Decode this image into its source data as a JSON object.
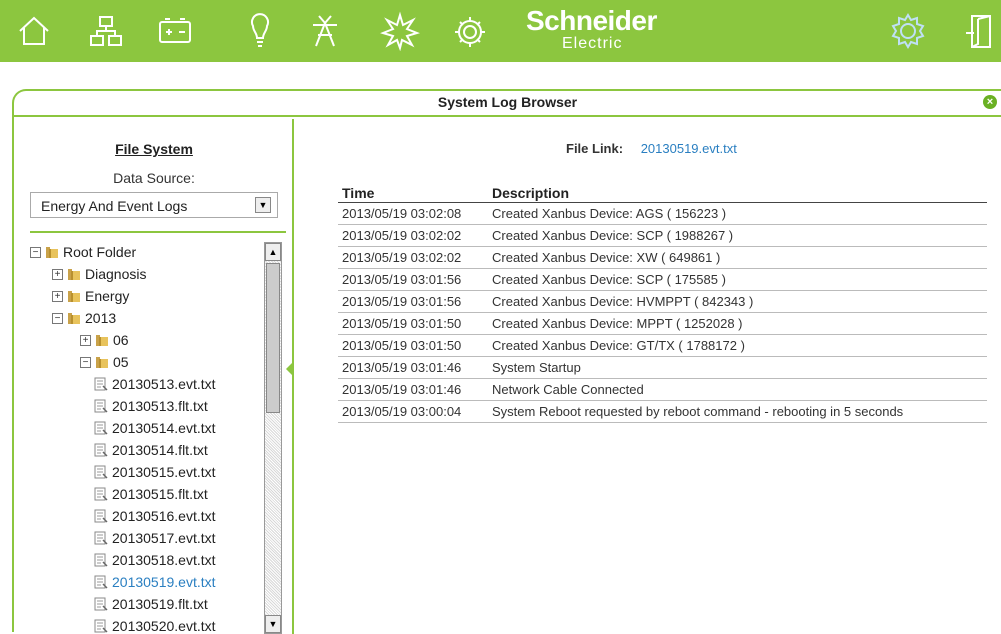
{
  "toolbar": {
    "icons": [
      "home-icon",
      "network-icon",
      "battery-icon",
      "lightbulb-icon",
      "tower-icon",
      "sun-burst-icon",
      "gear-panel-icon"
    ],
    "logo_line1": "Schneider",
    "logo_line2": "Electric",
    "right_icons": [
      "settings-icon",
      "exit-icon"
    ],
    "accent": "#8cc63f"
  },
  "panel": {
    "title": "System Log Browser",
    "close_label": "×"
  },
  "left": {
    "file_system_title": "File System",
    "data_source_label": "Data Source:",
    "data_source_value": "Energy And Event Logs"
  },
  "tree": [
    {
      "label": "Root Folder",
      "type": "folder",
      "toggle": "−",
      "depth": 0
    },
    {
      "label": "Diagnosis",
      "type": "folder",
      "toggle": "+",
      "depth": 1
    },
    {
      "label": "Energy",
      "type": "folder",
      "toggle": "+",
      "depth": 1
    },
    {
      "label": "2013",
      "type": "folder",
      "toggle": "−",
      "depth": 1
    },
    {
      "label": "06",
      "type": "folder",
      "toggle": "+",
      "depth": 2
    },
    {
      "label": "05",
      "type": "folder",
      "toggle": "−",
      "depth": 2
    },
    {
      "label": "20130513.evt.txt",
      "type": "file",
      "depth": 3
    },
    {
      "label": "20130513.flt.txt",
      "type": "file",
      "depth": 3
    },
    {
      "label": "20130514.evt.txt",
      "type": "file",
      "depth": 3
    },
    {
      "label": "20130514.flt.txt",
      "type": "file",
      "depth": 3
    },
    {
      "label": "20130515.evt.txt",
      "type": "file",
      "depth": 3
    },
    {
      "label": "20130515.flt.txt",
      "type": "file",
      "depth": 3
    },
    {
      "label": "20130516.evt.txt",
      "type": "file",
      "depth": 3
    },
    {
      "label": "20130517.evt.txt",
      "type": "file",
      "depth": 3
    },
    {
      "label": "20130518.evt.txt",
      "type": "file",
      "depth": 3
    },
    {
      "label": "20130519.evt.txt",
      "type": "file",
      "depth": 3,
      "selected": true
    },
    {
      "label": "20130519.flt.txt",
      "type": "file",
      "depth": 3
    },
    {
      "label": "20130520.evt.txt",
      "type": "file",
      "depth": 3
    }
  ],
  "right": {
    "file_link_label": "File Link:",
    "file_link_value": "20130519.evt.txt",
    "columns": [
      "Time",
      "Description"
    ],
    "rows": [
      [
        "2013/05/19 03:02:08",
        "Created Xanbus Device: AGS ( 156223 )"
      ],
      [
        "2013/05/19 03:02:02",
        "Created Xanbus Device: SCP ( 1988267 )"
      ],
      [
        "2013/05/19 03:02:02",
        "Created Xanbus Device: XW ( 649861 )"
      ],
      [
        "2013/05/19 03:01:56",
        "Created Xanbus Device: SCP ( 175585 )"
      ],
      [
        "2013/05/19 03:01:56",
        "Created Xanbus Device: HVMPPT ( 842343 )"
      ],
      [
        "2013/05/19 03:01:50",
        "Created Xanbus Device: MPPT ( 1252028 )"
      ],
      [
        "2013/05/19 03:01:50",
        "Created Xanbus Device: GT/TX ( 1788172 )"
      ],
      [
        "2013/05/19 03:01:46",
        "System Startup"
      ],
      [
        "2013/05/19 03:01:46",
        "Network Cable Connected"
      ],
      [
        "2013/05/19 03:00:04",
        "System Reboot requested by reboot command - rebooting in 5 seconds"
      ]
    ]
  }
}
